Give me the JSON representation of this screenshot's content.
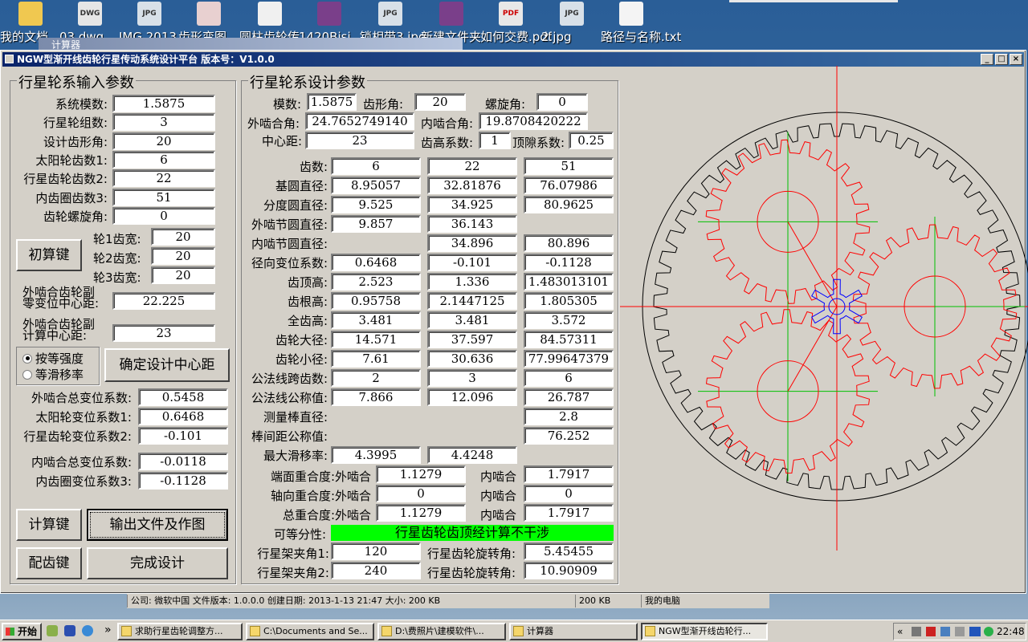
{
  "desktop": {
    "icons": [
      {
        "label": "我的文档",
        "badge": "",
        "color": "#f0c850"
      },
      {
        "label": "03.dwg",
        "badge": "DWG",
        "color": "#e6e6e6"
      },
      {
        "label": "JMG 2013",
        "badge": "JPG",
        "color": "#d8e0e8"
      },
      {
        "label": "齿形变图",
        "badge": "",
        "color": "#e8d0d0"
      },
      {
        "label": "圆柱齿轮传",
        "badge": "",
        "color": "#f0f0f0"
      },
      {
        "label": "1420Bisi",
        "badge": "",
        "color": "#7a3f8a"
      },
      {
        "label": "锁相带3.jpg",
        "badge": "JPG",
        "color": "#d8e0e8"
      },
      {
        "label": "新建文件夹",
        "badge": "",
        "color": "#7a3f8a"
      },
      {
        "label": "如何交费.pdf",
        "badge": "PDF",
        "color": "#e8e8e8"
      },
      {
        "label": "2.jpg",
        "badge": "JPG",
        "color": "#d8e0e8"
      },
      {
        "label": "路径与名称.txt",
        "badge": "",
        "color": "#f4f4f4"
      }
    ],
    "calc_ghost_title": "计算器"
  },
  "window": {
    "title": "NGW型渐开线齿轮行星传动系统设计平台  版本号：V1.0.0",
    "min": "_",
    "max": "□",
    "close": "×"
  },
  "input_panel": {
    "title": "行星轮系输入参数",
    "rows": [
      {
        "label": "系统模数:",
        "value": "1.5875"
      },
      {
        "label": "行星轮组数:",
        "value": "3"
      },
      {
        "label": "设计齿形角:",
        "value": "20"
      },
      {
        "label": "太阳轮齿数1:",
        "value": "6"
      },
      {
        "label": "行星齿轮齿数2:",
        "value": "22"
      },
      {
        "label": "内齿圈齿数3:",
        "value": "51"
      },
      {
        "label": "齿轮螺旋角:",
        "value": "0"
      }
    ],
    "init_button": "初算键",
    "widths": [
      {
        "label": "轮1齿宽:",
        "value": "20"
      },
      {
        "label": "轮2齿宽:",
        "value": "20"
      },
      {
        "label": "轮3齿宽:",
        "value": "20"
      }
    ],
    "zero_center_label_1": "外啮合齿轮副",
    "zero_center_label_2": "零变位中心距:",
    "zero_center_value": "22.225",
    "calc_center_label_1": "外啮合齿轮副",
    "calc_center_label_2": "计算中心距:",
    "calc_center_value": "23",
    "radio_strength": "按等强度",
    "radio_slip": "等滑移率",
    "confirm_center_button": "确定设计中心距",
    "ext_total_label": "外啮合总变位系数:",
    "ext_total_value": "0.5458",
    "sun_shift_label": "太阳轮变位系数1:",
    "sun_shift_value": "0.6468",
    "planet_shift_label": "行星齿轮变位系数2:",
    "planet_shift_value": "-0.101",
    "int_total_label": "内啮合总变位系数:",
    "int_total_value": "-0.0118",
    "ring_shift_label": "内齿圈变位系数3:",
    "ring_shift_value": "-0.1128",
    "calc_button": "计算键",
    "output_button": "输出文件及作图",
    "match_button": "配齿键",
    "finish_button": "完成设计"
  },
  "design_panel": {
    "title": "行星轮系设计参数",
    "module_label": "模数:",
    "module_value": "1.5875",
    "pressure_label": "齿形角:",
    "pressure_value": "20",
    "helix_label": "螺旋角:",
    "helix_value": "0",
    "ext_angle_label": "外啮合角:",
    "ext_angle_value": "24.7652749140",
    "int_angle_label": "内啮合角:",
    "int_angle_value": "19.8708420222",
    "center_label": "中心距:",
    "center_value": "23",
    "addendum_coef_label": "齿高系数:",
    "addendum_coef_value": "1",
    "clearance_label": "顶隙系数:",
    "clearance_value": "0.25",
    "table": [
      {
        "label": "齿数:",
        "v": [
          "6",
          "22",
          "51"
        ]
      },
      {
        "label": "基圆直径:",
        "v": [
          "8.95057",
          "32.81876",
          "76.07986"
        ]
      },
      {
        "label": "分度圆直径:",
        "v": [
          "9.525",
          "34.925",
          "80.9625"
        ]
      },
      {
        "label": "外啮节圆直径:",
        "v": [
          "9.857",
          "36.143",
          ""
        ]
      },
      {
        "label": "内啮节圆直径:",
        "v": [
          "",
          "34.896",
          "80.896"
        ]
      },
      {
        "label": "径向变位系数:",
        "v": [
          "0.6468",
          "-0.101",
          "-0.1128"
        ]
      },
      {
        "label": "齿顶高:",
        "v": [
          "2.523",
          "1.336",
          "1.483013101"
        ]
      },
      {
        "label": "齿根高:",
        "v": [
          "0.95758",
          "2.1447125",
          "1.805305"
        ]
      },
      {
        "label": "全齿高:",
        "v": [
          "3.481",
          "3.481",
          "3.572"
        ]
      },
      {
        "label": "齿轮大径:",
        "v": [
          "14.571",
          "37.597",
          "84.57311"
        ]
      },
      {
        "label": "齿轮小径:",
        "v": [
          "7.61",
          "30.636",
          "77.99647379"
        ]
      },
      {
        "label": "公法线跨齿数:",
        "v": [
          "2",
          "3",
          "6"
        ]
      },
      {
        "label": "公法线公称值:",
        "v": [
          "7.866",
          "12.096",
          "26.787"
        ]
      },
      {
        "label": "测量棒直径:",
        "v": [
          "",
          "",
          "2.8"
        ]
      },
      {
        "label": "棒间距公称值:",
        "v": [
          "",
          "",
          "76.252"
        ]
      },
      {
        "label": "最大滑移率:",
        "v": [
          "4.3995",
          "4.4248",
          ""
        ]
      }
    ],
    "transverse_label": "端面重合度:外啮合",
    "transverse_ext": "1.1279",
    "transverse_int_label": "内啮合",
    "transverse_int": "1.7917",
    "axial_label": "轴向重合度:外啮合",
    "axial_ext": "0",
    "axial_int_label": "内啮合",
    "axial_int": "0",
    "total_label": "总重合度:外啮合",
    "total_ext": "1.1279",
    "total_int_label": "内啮合",
    "total_int": "1.7917",
    "divisible_label": "可等分性:",
    "divisible_status": "行星齿轮齿顶经计算不干涉",
    "carrier1_label": "行星架夹角1:",
    "carrier1_value": "120",
    "rot1_label": "行星齿轮旋转角:",
    "rot1_value": "5.45455",
    "carrier2_label": "行星架夹角2:",
    "carrier2_value": "240",
    "rot2_label": "行星齿轮旋转角:",
    "rot2_value": "10.90909"
  },
  "gear_diagram": {
    "sun_teeth": 6,
    "planet_teeth": 22,
    "ring_teeth": 51,
    "planet_count": 3,
    "colors": {
      "ring": "#000000",
      "planet": "#ff0000",
      "sun": "#0000ff",
      "axis_red": "#ff0000",
      "axis_green": "#00c000"
    }
  },
  "statusbar": {
    "info": "公司: 微软中国 文件版本: 1.0.0.0 创建日期: 2013-1-13 21:47 大小: 200 KB",
    "size": "200 KB",
    "location": "我的电脑"
  },
  "taskbar": {
    "start": "开始",
    "tasks": [
      {
        "label": "求助行星齿轮调整方..."
      },
      {
        "label": "C:\\Documents and Se..."
      },
      {
        "label": "D:\\费照片\\建模软件\\..."
      },
      {
        "label": "计算器"
      },
      {
        "label": "NGW型渐开线齿轮行..."
      }
    ],
    "chevron": "»",
    "tray_chevron": "«",
    "time": "22:48"
  }
}
